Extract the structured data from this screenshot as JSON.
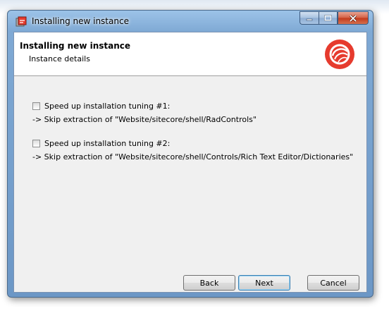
{
  "window": {
    "title": "Installing new instance"
  },
  "header": {
    "title": "Installing new instance",
    "subtitle": "Instance details"
  },
  "options": [
    {
      "label": "Speed up installation tuning #1:",
      "detail": "-> Skip extraction of \"Website/sitecore/shell/RadControls\"",
      "checked": false
    },
    {
      "label": "Speed up installation tuning #2:",
      "detail": "-> Skip extraction of \"Website/sitecore/shell/Controls/Rich Text Editor/Dictionaries\"",
      "checked": false
    }
  ],
  "buttons": {
    "back": "Back",
    "next": "Next",
    "cancel": "Cancel"
  },
  "colors": {
    "brand_red": "#e63b2e",
    "title_bar": "#7fa9d4",
    "close_button": "#c2391b"
  }
}
